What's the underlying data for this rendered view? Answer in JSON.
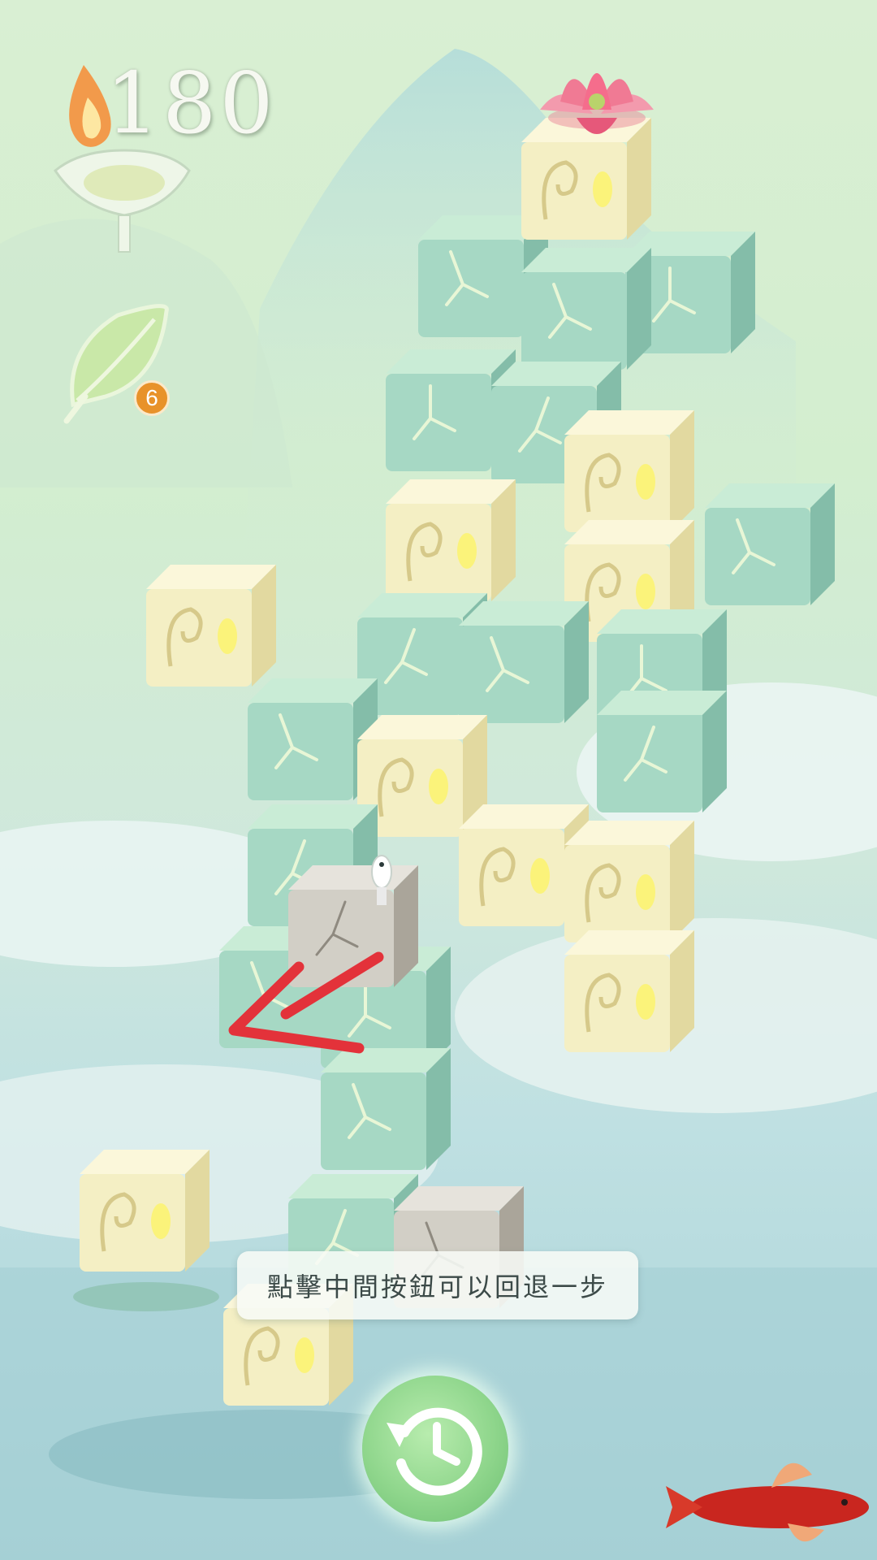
{
  "hud": {
    "score": "180",
    "leaf_count": "6",
    "flame_icon": "candle-flame-icon",
    "leaf_icon": "leaf-icon"
  },
  "tutorial": {
    "hint": "點擊中間按鈕可以回退一步"
  },
  "controls": {
    "undo_icon": "undo-clock-icon"
  },
  "colors": {
    "jade_block": "#a6d8c4",
    "glyph_block": "#f4efc4",
    "stone_block": "#d2cfc6",
    "arrow": "#e3323a",
    "badge": "#e8922a",
    "undo_button": "#8fd68c"
  }
}
